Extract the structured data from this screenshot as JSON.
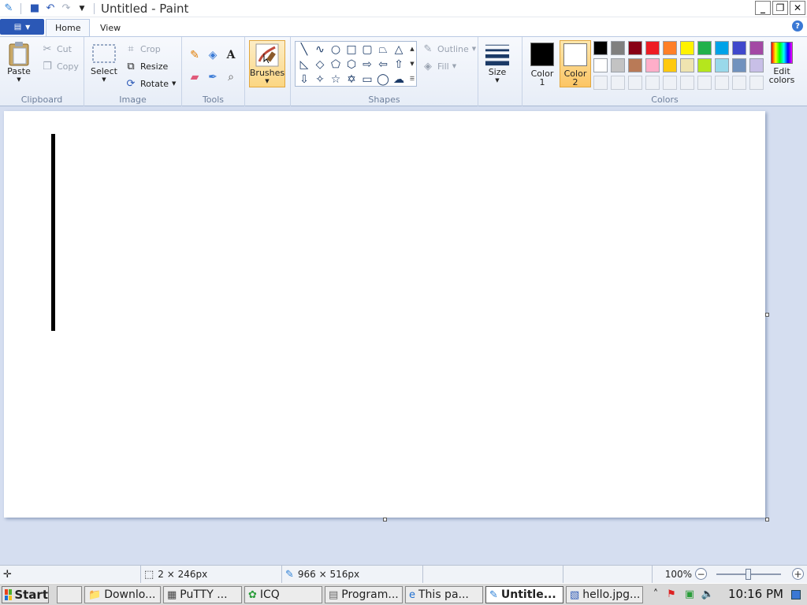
{
  "window": {
    "title": "Untitled - Paint",
    "controls": {
      "minimize": "_",
      "restore": "❐",
      "close": "✕"
    }
  },
  "tabs": [
    {
      "label": "Home",
      "active": true
    },
    {
      "label": "View",
      "active": false
    }
  ],
  "ribbon": {
    "clipboard": {
      "label": "Clipboard",
      "paste": "Paste",
      "cut": "Cut",
      "copy": "Copy"
    },
    "image": {
      "label": "Image",
      "select": "Select",
      "crop": "Crop",
      "resize": "Resize",
      "rotate": "Rotate"
    },
    "tools": {
      "label": "Tools"
    },
    "brushes": {
      "label": "Brushes"
    },
    "shapes": {
      "label": "Shapes",
      "outline": "Outline",
      "fill": "Fill"
    },
    "size": {
      "label": "Size"
    },
    "colors": {
      "label": "Colors",
      "color1_line1": "Color",
      "color1_line2": "1",
      "color1_value": "#000000",
      "color2_line1": "Color",
      "color2_line2": "2",
      "color2_value": "#ffffff",
      "edit_line1": "Edit",
      "edit_line2": "colors",
      "palette_row1": [
        "#000000",
        "#7f7f7f",
        "#880015",
        "#ed1c24",
        "#ff7f27",
        "#fff200",
        "#22b14c",
        "#00a2e8",
        "#3f48cc",
        "#a349a4"
      ],
      "palette_row2": [
        "#ffffff",
        "#c3c3c3",
        "#b97a57",
        "#ffaec9",
        "#ffc90e",
        "#efe4b0",
        "#b5e61d",
        "#99d9ea",
        "#7092be",
        "#c8bfe7"
      ]
    }
  },
  "status": {
    "selection_size": "2 × 246px",
    "canvas_size": "966 × 516px",
    "zoom": "100%"
  },
  "taskbar": {
    "start": "Start",
    "items": [
      {
        "label": "",
        "icon": "blank-window-icon"
      },
      {
        "label": "Downlo...",
        "icon": "folder-icon"
      },
      {
        "label": "PuTTY ...",
        "icon": "putty-icon"
      },
      {
        "label": "ICQ",
        "icon": "icq-flower-icon"
      },
      {
        "label": "Program...",
        "icon": "document-icon"
      },
      {
        "label": "This pa...",
        "icon": "internet-explorer-icon"
      },
      {
        "label": "Untitle...",
        "icon": "paint-icon",
        "active": true
      },
      {
        "label": "hello.jpg...",
        "icon": "image-viewer-icon"
      }
    ],
    "clock": "10:16 PM"
  }
}
